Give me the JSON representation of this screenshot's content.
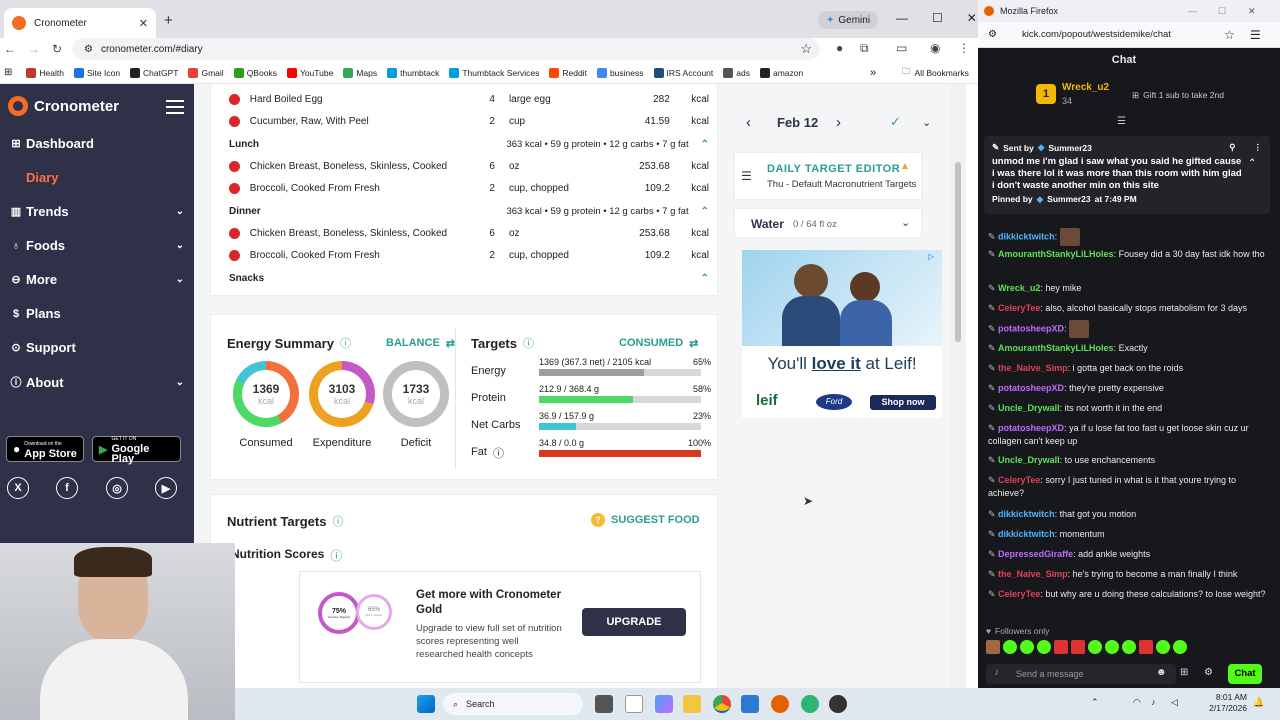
{
  "chrome": {
    "tab_title": "Cronometer",
    "tab_close": "✕",
    "new_tab": "+",
    "gemini": "Gemini",
    "url": "cronometer.com/#diary",
    "bookmarks": [
      "Health",
      "Site Icon",
      "ChatGPT",
      "Gmail",
      "QBooks",
      "YouTube",
      "Maps",
      "thumbtack",
      "Thumbtack Services",
      "Reddit",
      "business",
      "IRS Account",
      "ads",
      "amazon"
    ],
    "bookmark_colors": [
      "#c0392b",
      "#1a73e8",
      "#222222",
      "#ea4335",
      "#2ca01c",
      "#ff0000",
      "#34a853",
      "#009fd9",
      "#009fd9",
      "#ff4500",
      "#4285f4",
      "#1f4e79",
      "#555555",
      "#222222"
    ],
    "all_bookmarks": "All Bookmarks",
    "more": "»"
  },
  "sidebar": {
    "brand": "Cronometer",
    "items": [
      {
        "label": "Dashboard",
        "icon": "dashboard-icon",
        "glyph": "⊞",
        "chev": ""
      },
      {
        "label": "Diary",
        "icon": "diary-icon",
        "glyph": "",
        "chev": ""
      },
      {
        "label": "Trends",
        "icon": "trends-icon",
        "glyph": "▥",
        "chev": "⌄"
      },
      {
        "label": "Foods",
        "icon": "foods-icon",
        "glyph": "♁",
        "chev": "⌄"
      },
      {
        "label": "More",
        "icon": "more-icon",
        "glyph": "⊖",
        "chev": "⌄"
      },
      {
        "label": "Plans",
        "icon": "plans-icon",
        "glyph": "$",
        "chev": ""
      },
      {
        "label": "Support",
        "icon": "support-icon",
        "glyph": "⊙",
        "chev": ""
      },
      {
        "label": "About",
        "icon": "about-icon",
        "glyph": "ⓘ",
        "chev": "⌄"
      }
    ],
    "app_store": "App Store",
    "app_store_small": "Download on the",
    "google_play": "Google Play",
    "google_play_small": "GET IT ON",
    "social": [
      "X",
      "f",
      "◎",
      "▶"
    ]
  },
  "diary": {
    "rows_breakfast": [
      {
        "name": "Hard Boiled Egg",
        "qty": "4",
        "unit": "large egg",
        "cal": "282",
        "kcal": "kcal"
      },
      {
        "name": "Cucumber, Raw, With Peel",
        "qty": "2",
        "unit": "cup",
        "cal": "41.59",
        "kcal": "kcal"
      }
    ],
    "lunch": {
      "label": "Lunch",
      "summary": "363 kcal • 59 g protein • 12 g carbs • 7 g fat"
    },
    "rows_lunch": [
      {
        "name": "Chicken Breast, Boneless, Skinless, Cooked",
        "qty": "6",
        "unit": "oz",
        "cal": "253.68",
        "kcal": "kcal"
      },
      {
        "name": "Broccoli, Cooked From Fresh",
        "qty": "2",
        "unit": "cup, chopped",
        "cal": "109.2",
        "kcal": "kcal"
      }
    ],
    "dinner": {
      "label": "Dinner",
      "summary": "363 kcal • 59 g protein • 12 g carbs • 7 g fat"
    },
    "rows_dinner": [
      {
        "name": "Chicken Breast, Boneless, Skinless, Cooked",
        "qty": "6",
        "unit": "oz",
        "cal": "253.68",
        "kcal": "kcal"
      },
      {
        "name": "Broccoli, Cooked From Fresh",
        "qty": "2",
        "unit": "cup, chopped",
        "cal": "109.2",
        "kcal": "kcal"
      }
    ],
    "snacks": "Snacks"
  },
  "energy": {
    "title": "Energy Summary",
    "balance": "BALANCE",
    "consumed": {
      "value": "1369",
      "unit": "kcal",
      "label": "Consumed"
    },
    "expenditure": {
      "value": "3103",
      "unit": "kcal",
      "label": "Expenditure"
    },
    "deficit": {
      "value": "1733",
      "unit": "kcal",
      "label": "Deficit"
    }
  },
  "targets": {
    "title": "Targets",
    "consumed_label": "CONSUMED",
    "rows": [
      {
        "name": "Energy",
        "text": "1369 (367.3 net) / 2105 kcal",
        "pct": "65%",
        "fill": 0.65,
        "color": "#9e9e9e"
      },
      {
        "name": "Protein",
        "text": "212.9 / 368.4 g",
        "pct": "58%",
        "fill": 0.58,
        "color": "#4cd964"
      },
      {
        "name": "Net Carbs",
        "text": "36.9 / 157.9 g",
        "pct": "23%",
        "fill": 0.23,
        "color": "#40c4d6"
      },
      {
        "name": "Fat",
        "text": "34.8 / 0.0 g",
        "pct": "100%",
        "fill": 1.0,
        "color": "#d93a1e"
      }
    ]
  },
  "nutrient": {
    "title": "Nutrient Targets",
    "suggest": "SUGGEST FOOD",
    "scores_title": "Nutrition Scores",
    "all_targets_pct": "83%",
    "all_targets": "All Targets",
    "mini1_pct": "75%",
    "mini1_label": "Immune Support",
    "mini2_pct": "65%",
    "mini2_label": "Bone Health",
    "gold_title": "Get more with Cronometer Gold",
    "gold_body": "Upgrade to view full set of nutrition scores representing well researched health concepts",
    "upgrade": "UPGRADE"
  },
  "rightcol": {
    "date": "Feb 12",
    "dte_title": "DAILY TARGET EDITOR",
    "dte_sub": "Thu - Default Macronutrient Targets",
    "water": "Water",
    "water_val": "0 / 64 fl oz",
    "ad_text_a": "You'll ",
    "ad_text_b": "love it",
    "ad_text_c": " at Leif!",
    "ad_brand": "leif",
    "ad_brand2": "Ford",
    "shop_now": "Shop now"
  },
  "firefox": {
    "title": "Mozilla Firefox",
    "url": "kick.com/popout/westsidemike/chat"
  },
  "chat": {
    "header": "Chat",
    "top_user": "Wreck_u2",
    "top_count": "34",
    "gift": "Gift 1 sub to take 2nd",
    "pin_sent_by": "Sent by",
    "pin_user": "Summer23",
    "pin_text": "unmod me i'm glad i saw what you said he gifted cause i was there lol it was more than this room with him glad i don't waste another min on this site",
    "pin_pinned_by": "Pinned by",
    "pin_time": "at 7:49 PM",
    "messages": [
      {
        "user": "dikkicktwitch",
        "color": "#4fb3ff",
        "text": "",
        "emote": true
      },
      {
        "user": "AmouranthStankyLiLHoles",
        "color": "#5ee05a",
        "text": "Fousey did a 30 day fast idk how tho",
        "emote": false
      },
      {
        "user": "Wreck_u2",
        "color": "#5ee05a",
        "text": "hey mike",
        "emote": false
      },
      {
        "user": "CeleryTee",
        "color": "#e0405a",
        "text": "also, alcohol basically stops metabolism for 3 days",
        "emote": false
      },
      {
        "user": "potatosheepXD",
        "color": "#bd6cff",
        "text": "",
        "emote": true
      },
      {
        "user": "AmouranthStankyLiLHoles",
        "color": "#5ee05a",
        "text": "Exactly",
        "emote": false
      },
      {
        "user": "the_Naive_Simp",
        "color": "#e0405a",
        "text": "i gotta get back on the roids",
        "emote": false
      },
      {
        "user": "potatosheepXD",
        "color": "#bd6cff",
        "text": "they're pretty expensive",
        "emote": false
      },
      {
        "user": "Uncle_Drywall",
        "color": "#5ee05a",
        "text": "its not worth it in the end",
        "emote": false
      },
      {
        "user": "potatosheepXD",
        "color": "#bd6cff",
        "text": "ya if u lose fat too fast u get loose skin cuz ur collagen can't keep up",
        "emote": false
      },
      {
        "user": "Uncle_Drywall",
        "color": "#5ee05a",
        "text": "to use enchancements",
        "emote": false
      },
      {
        "user": "CeleryTee",
        "color": "#e0405a",
        "text": "sorry I just tuned in what is it that youre trying to achieve?",
        "emote": false
      },
      {
        "user": "dikkicktwitch",
        "color": "#4fb3ff",
        "text": "that got you motion",
        "emote": false
      },
      {
        "user": "dikkicktwitch",
        "color": "#4fb3ff",
        "text": "momentum",
        "emote": false
      },
      {
        "user": "DepressedGiraffe",
        "color": "#bd6cff",
        "text": "add ankle weights",
        "emote": false
      },
      {
        "user": "the_Naive_Simp",
        "color": "#e0405a",
        "text": "he's trying to become a man finally I think",
        "emote": false
      },
      {
        "user": "CeleryTee",
        "color": "#e0405a",
        "text": "but why are u doing these calculations? to lose weight?",
        "emote": false
      }
    ],
    "followers_only": "Followers only",
    "send_placeholder": "Send a message",
    "chat_button": "Chat"
  },
  "taskbar": {
    "search": "Search",
    "time": "8:01 AM",
    "date": "2/17/2026"
  }
}
